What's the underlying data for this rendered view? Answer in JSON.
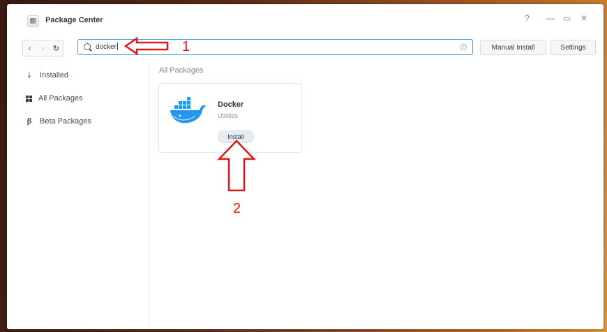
{
  "window": {
    "title": "Package Center",
    "controls": {
      "help": "?",
      "minimize": "—",
      "maximize": "▭",
      "close": "✕"
    }
  },
  "toolbar": {
    "back_icon": "chevron-left-icon",
    "forward_icon": "chevron-right-icon",
    "refresh_icon": "refresh-icon",
    "search": {
      "value": "docker",
      "icon": "search-icon",
      "clear_icon": "clear-icon"
    },
    "manual_install_label": "Manual Install",
    "settings_label": "Settings"
  },
  "sidebar": {
    "items": [
      {
        "label": "Installed",
        "icon": "download-icon",
        "glyph": "⤓"
      },
      {
        "label": "All Packages",
        "icon": "grid-icon"
      },
      {
        "label": "Beta Packages",
        "icon": "beta-icon",
        "glyph": "β"
      }
    ]
  },
  "main": {
    "section_title": "All Packages",
    "packages": [
      {
        "name": "Docker",
        "category": "Utilities",
        "action_label": "Install",
        "icon": "docker-logo"
      }
    ]
  },
  "annotations": [
    {
      "label": "1",
      "shape": "arrow-left",
      "color": "#e01515"
    },
    {
      "label": "2",
      "shape": "arrow-up",
      "color": "#e01515"
    }
  ]
}
